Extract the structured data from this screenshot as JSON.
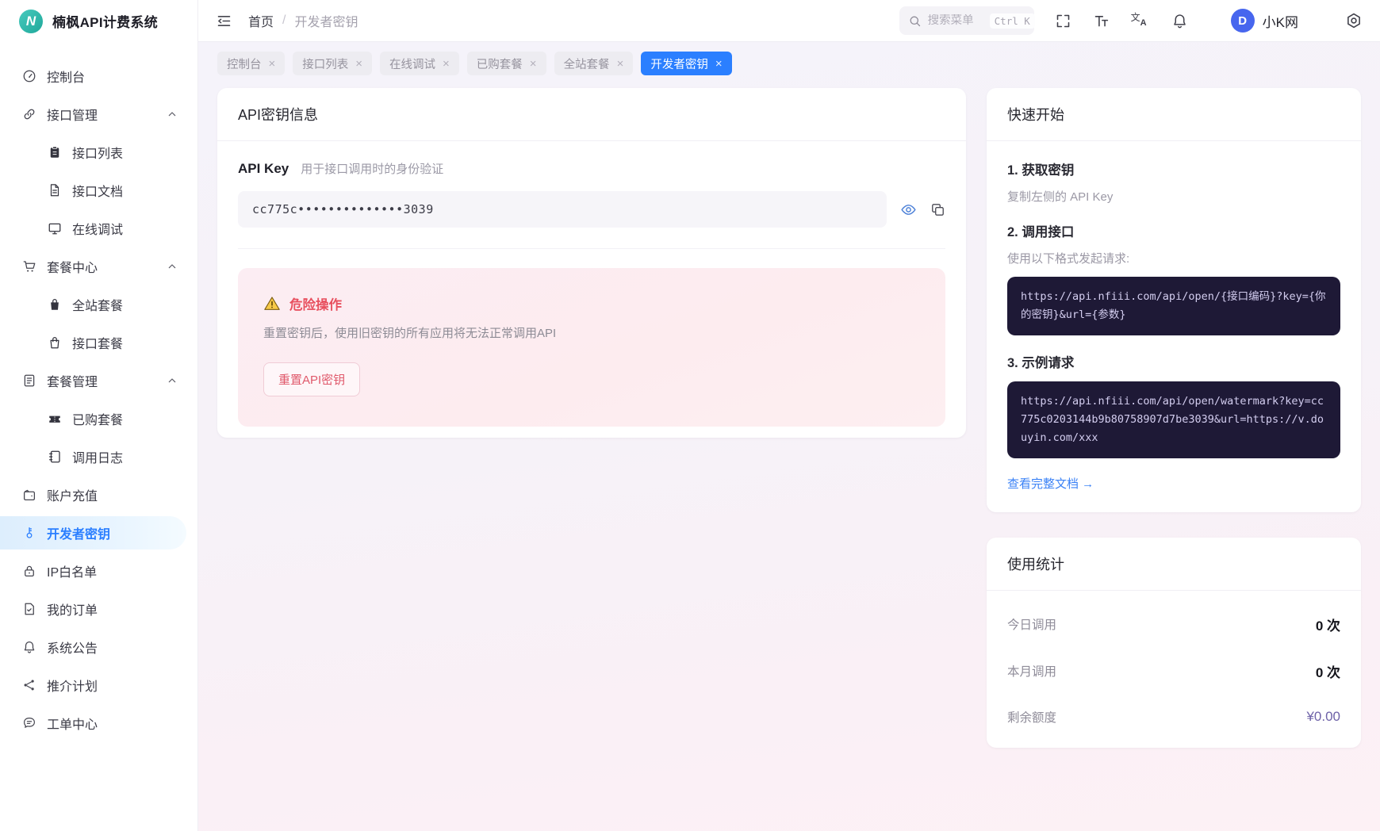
{
  "app": {
    "title": "楠枫API计费系统",
    "logo_letter": "N"
  },
  "glyphs": {
    "close": "×",
    "slash": "/",
    "translate_cjk": "文",
    "translate_latin": "A"
  },
  "header": {
    "breadcrumb": {
      "home": "首页",
      "current": "开发者密钥"
    },
    "search": {
      "placeholder": "搜索菜单",
      "shortcut": "Ctrl K"
    },
    "user": {
      "avatar_letter": "D",
      "name": "小K网"
    }
  },
  "tabs": [
    {
      "label": "控制台",
      "active": false
    },
    {
      "label": "接口列表",
      "active": false
    },
    {
      "label": "在线调试",
      "active": false
    },
    {
      "label": "已购套餐",
      "active": false
    },
    {
      "label": "全站套餐",
      "active": false
    },
    {
      "label": "开发者密钥",
      "active": true
    }
  ],
  "sidebar": {
    "items": [
      {
        "label": "控制台",
        "icon": "gauge"
      },
      {
        "label": "接口管理",
        "icon": "api-link",
        "expanded": true
      },
      {
        "label": "接口列表",
        "icon": "clipboard",
        "child": true
      },
      {
        "label": "接口文档",
        "icon": "document",
        "child": true
      },
      {
        "label": "在线调试",
        "icon": "monitor",
        "child": true
      },
      {
        "label": "套餐中心",
        "icon": "cart",
        "expanded": true
      },
      {
        "label": "全站套餐",
        "icon": "bag-filled",
        "child": true
      },
      {
        "label": "接口套餐",
        "icon": "bag",
        "child": true
      },
      {
        "label": "套餐管理",
        "icon": "doc-list",
        "expanded": true
      },
      {
        "label": "已购套餐",
        "icon": "ticket",
        "child": true
      },
      {
        "label": "调用日志",
        "icon": "notebook",
        "child": true
      },
      {
        "label": "账户充值",
        "icon": "wallet"
      },
      {
        "label": "开发者密钥",
        "icon": "key",
        "active": true
      },
      {
        "label": "IP白名单",
        "icon": "lock"
      },
      {
        "label": "我的订单",
        "icon": "order"
      },
      {
        "label": "系统公告",
        "icon": "bell"
      },
      {
        "label": "推介计划",
        "icon": "share"
      },
      {
        "label": "工单中心",
        "icon": "chat"
      }
    ]
  },
  "main": {
    "key_card": {
      "title": "API密钥信息",
      "field_label": "API Key",
      "field_desc": "用于接口调用时的身份验证",
      "masked_key": "cc775c••••••••••••••3039",
      "danger": {
        "title": "危险操作",
        "desc": "重置密钥后，使用旧密钥的所有应用将无法正常调用API",
        "button": "重置API密钥"
      }
    },
    "quick_start": {
      "title": "快速开始",
      "steps": [
        {
          "heading": "1. 获取密钥",
          "desc": "复制左侧的 API Key"
        },
        {
          "heading": "2. 调用接口",
          "desc": "使用以下格式发起请求:",
          "code": "https://api.nfiii.com/api/open/{接口编码}?key={你的密钥}&url={参数}"
        },
        {
          "heading": "3. 示例请求",
          "code": "https://api.nfiii.com/api/open/watermark?key=cc775c0203144b9b80758907d7be3039&url=https://v.douyin.com/xxx"
        }
      ],
      "doc_link": "查看完整文档 →"
    },
    "usage": {
      "title": "使用统计",
      "rows": [
        {
          "label": "今日调用",
          "value": "0 次"
        },
        {
          "label": "本月调用",
          "value": "0 次"
        },
        {
          "label": "剩余额度",
          "value": "¥0.00",
          "highlight": true
        }
      ]
    }
  },
  "colors": {
    "accent_blue": "#2b7fff",
    "logo_teal": "#2fb3a6",
    "danger_red": "#e8505f",
    "link_blue": "#3b82f6",
    "quota_purple": "#6e62a8",
    "code_bg": "#1e1936"
  }
}
